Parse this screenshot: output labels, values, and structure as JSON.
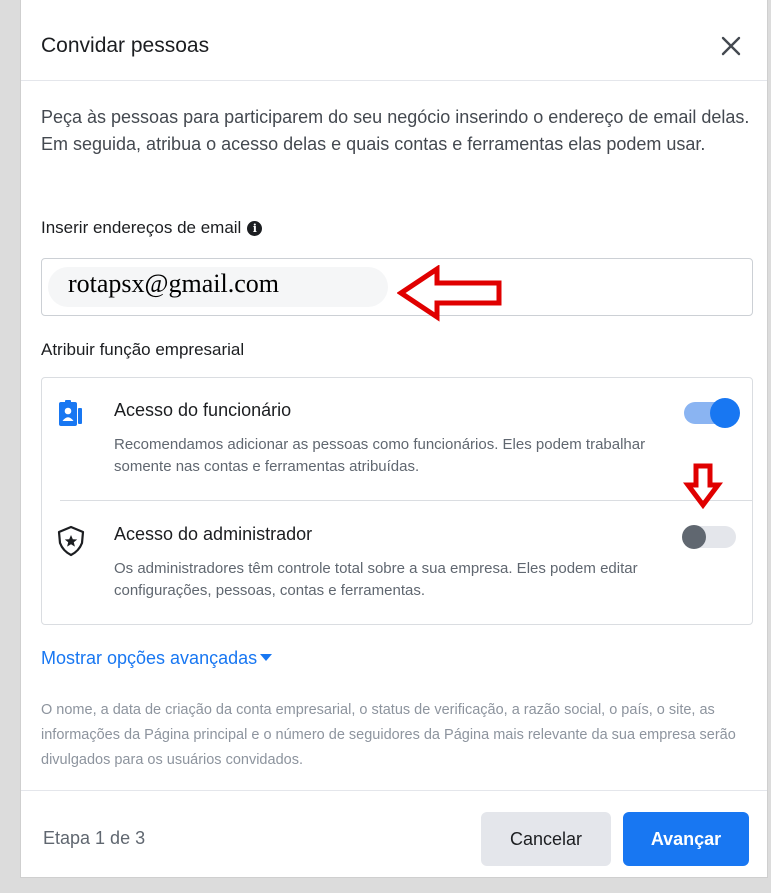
{
  "dialog": {
    "title": "Convidar pessoas",
    "intro": "Peça às pessoas para participarem do seu negócio inserindo o endereço de email delas. Em seguida, atribua o acesso delas e quais contas e ferramentas elas podem usar.",
    "email_label": "Inserir endereços de email",
    "email_value": "rotapsx@gmail.com",
    "role_label": "Atribuir função empresarial",
    "roles": [
      {
        "title": "Acesso do funcionário",
        "description": "Recomendamos adicionar as pessoas como funcionários. Eles podem trabalhar somente nas contas e ferramentas atribuídas.",
        "enabled": true,
        "icon": "employee-badge-icon"
      },
      {
        "title": "Acesso do administrador",
        "description": "Os administradores têm controle total sobre a sua empresa. Eles podem editar configurações, pessoas, contas e ferramentas.",
        "enabled": false,
        "icon": "admin-shield-icon"
      }
    ],
    "advanced_link": "Mostrar opções avançadas",
    "disclaimer": "O nome, a data de criação da conta empresarial, o status de verificação, a razão social, o país, o site, as informações da Página principal e o número de seguidores da Página mais relevante da sua empresa serão divulgados para os usuários convidados.",
    "step": "Etapa 1 de 3",
    "cancel_label": "Cancelar",
    "next_label": "Avançar"
  },
  "colors": {
    "accent": "#1877f2",
    "annotation": "#e00000"
  }
}
